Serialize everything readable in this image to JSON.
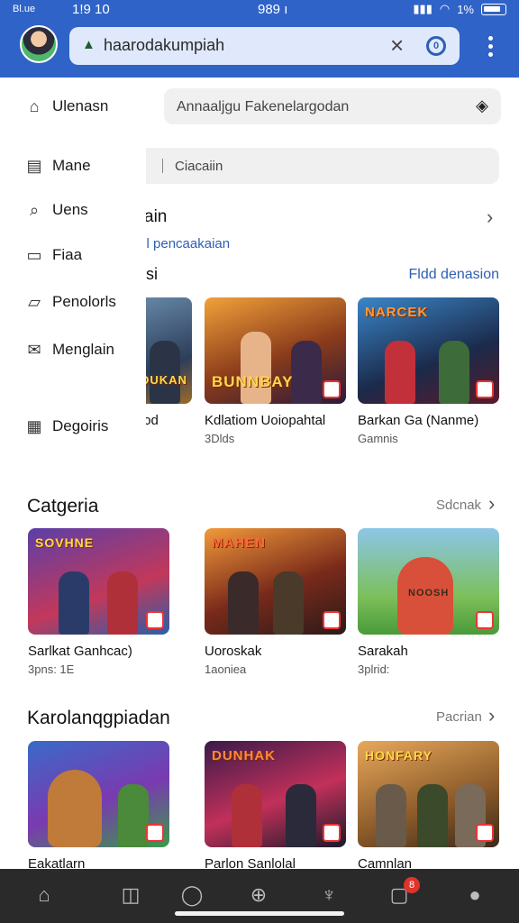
{
  "status": {
    "carrier": "Bl.ue",
    "time": "1!9 10",
    "center": "989 ı",
    "battery": "1%"
  },
  "browser": {
    "url": "haarodakumpiah",
    "tab_count": "0"
  },
  "drawer": {
    "home_label": "Ulenasn",
    "items": [
      {
        "label": "Mane",
        "icon": "calendar-icon"
      },
      {
        "label": "Uens",
        "icon": "search-icon"
      },
      {
        "label": "Fiaa",
        "icon": "doc-icon"
      },
      {
        "label": "Penolorls",
        "icon": "chat-icon"
      },
      {
        "label": "Menglain",
        "icon": "mail-icon"
      },
      {
        "label": "Degoiris",
        "icon": "grid-icon"
      }
    ]
  },
  "top_search": {
    "placeholder": "Annaaljgu Fakenelargodan"
  },
  "second_search": {
    "placeholder": "Ciacaiin"
  },
  "section0": {
    "title_fragment": "ain",
    "link_fragment": "a l pencaakaian",
    "row_title_fragment": "si",
    "row_link": "Fldd denasion"
  },
  "cards_row0": [
    {
      "title": "ɔd",
      "sub": ""
    },
    {
      "title": "Kdlatiom Uoiopahtal",
      "sub": "3Dlds"
    },
    {
      "title": "Barkan Ga (Nanme)",
      "sub": "Gamnis"
    }
  ],
  "section1": {
    "title": "Catgeria",
    "link": "Sdcnak"
  },
  "cards_row1": [
    {
      "title": "Sarlkat Ganhcac)",
      "sub": "3pns: 1E"
    },
    {
      "title": "Uoroskak",
      "sub": "1aoniea"
    },
    {
      "title": "Sarakah",
      "sub": "3plrid:"
    }
  ],
  "section2": {
    "title": "Karolanqgpiadan",
    "link": "Pacrian"
  },
  "cards_row2": [
    {
      "title": "Eakatlarn",
      "sub": ""
    },
    {
      "title": "Parlon Sanlolal",
      "sub": ""
    },
    {
      "title": "Camnlan",
      "sub": ""
    }
  ],
  "thumb_text": [
    "DUKAN",
    "BUNNBAY",
    "NARCEK",
    "SOVHNE",
    "MAHEN",
    "NOOSH",
    "DUNHAK",
    "HONFARY"
  ],
  "bottom_nav": {
    "badge": "8"
  }
}
